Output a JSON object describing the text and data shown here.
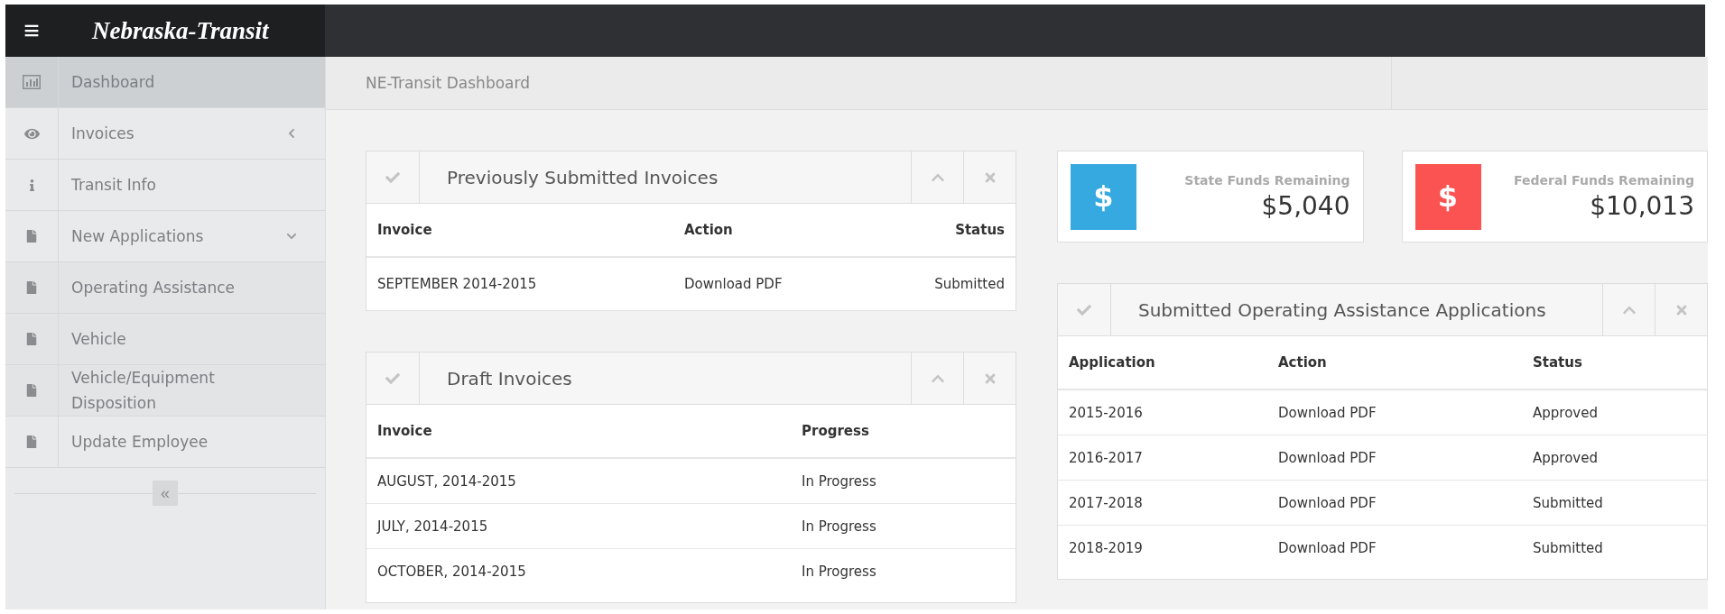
{
  "header": {
    "menu_label": "≡",
    "logo": "Nebraska-Transit"
  },
  "sidebar": {
    "items": [
      {
        "label": "Dashboard",
        "kind": "chart",
        "selected": true
      },
      {
        "label": "Invoices",
        "kind": "eye",
        "selected": false,
        "expanded": false
      },
      {
        "label": "Transit Info",
        "kind": "info",
        "selected": false
      },
      {
        "label": "New Applications",
        "kind": "file",
        "selected": false,
        "expanded": true,
        "children": [
          {
            "label": "Operating Assistance",
            "kind": "file",
            "selected": false
          },
          {
            "label": "Vehicle",
            "kind": "file",
            "selected": false
          },
          {
            "label": "Vehicle/Equipment Disposition",
            "kind": "file",
            "selected": false
          }
        ]
      },
      {
        "label": "Update Employee",
        "kind": "file",
        "selected": false
      }
    ],
    "collapse_label": "«"
  },
  "breadcrumb": "NE-Transit Dashboard",
  "left_panels": [
    {
      "title": "Previously Submitted Invoices",
      "columns": [
        "Invoice",
        "Action",
        "Status"
      ],
      "rows": [
        [
          "SEPTEMBER 2014-2015",
          "Download PDF",
          "Submitted"
        ]
      ]
    },
    {
      "title": "Draft Invoices",
      "columns": [
        "Invoice",
        "Progress"
      ],
      "rows": [
        [
          "AUGUST, 2014-2015",
          "In Progress"
        ],
        [
          "JULY, 2014-2015",
          "In Progress"
        ],
        [
          "OCTOBER, 2014-2015",
          "In Progress"
        ]
      ]
    }
  ],
  "stats": [
    {
      "label": "State Funds Remaining",
      "value": "$5,040",
      "color": "#35a9e0",
      "symbol": "$"
    },
    {
      "label": "Federal Funds Remaining",
      "value": "$10,013",
      "color": "#fb5252",
      "symbol": "$"
    }
  ],
  "right_panels": [
    {
      "title": "Submitted Operating Assistance Applications",
      "columns": [
        "Application",
        "Action",
        "Status"
      ],
      "rows": [
        [
          "2015-2016",
          "Download PDF",
          "Approved"
        ],
        [
          "2016-2017",
          "Download PDF",
          "Approved"
        ],
        [
          "2017-2018",
          "Download PDF",
          "Submitted"
        ],
        [
          "2018-2019",
          "Download PDF",
          "Submitted"
        ]
      ]
    }
  ]
}
